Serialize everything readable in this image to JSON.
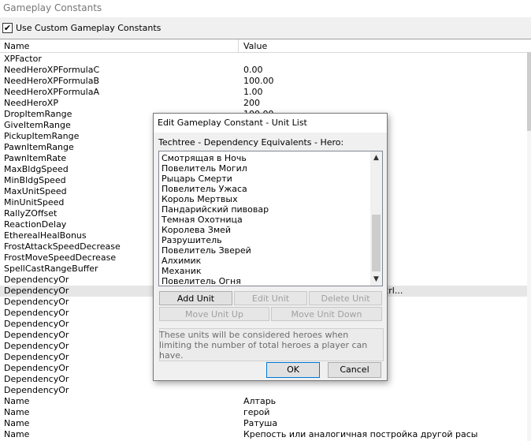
{
  "window": {
    "title": "Gameplay Constants"
  },
  "use_custom": {
    "checked_glyph": "✔",
    "label": "Use Custom Gameplay Constants"
  },
  "grid": {
    "col_name": "Name",
    "col_value": "Value",
    "rows": [
      {
        "name": "XPFactor",
        "value": ""
      },
      {
        "name": "NeedHeroXPFormulaC",
        "value": "0.00"
      },
      {
        "name": "NeedHeroXPFormulaB",
        "value": "100.00"
      },
      {
        "name": "NeedHeroXPFormulaA",
        "value": "1.00"
      },
      {
        "name": "NeedHeroXP",
        "value": "200"
      },
      {
        "name": "DropItemRange",
        "value": "100.00"
      },
      {
        "name": "GiveItemRange",
        "value": ""
      },
      {
        "name": "PickupItemRange",
        "value": ""
      },
      {
        "name": "PawnItemRange",
        "value": ""
      },
      {
        "name": "PawnItemRate",
        "value": ""
      },
      {
        "name": "MaxBldgSpeed",
        "value": ""
      },
      {
        "name": "MinBldgSpeed",
        "value": ""
      },
      {
        "name": "MaxUnitSpeed",
        "value": ""
      },
      {
        "name": "MinUnitSpeed",
        "value": ""
      },
      {
        "name": "RallyZOffset",
        "value": ""
      },
      {
        "name": "ReactionDelay",
        "value": ""
      },
      {
        "name": "EtherealHealBonus",
        "value": ""
      },
      {
        "name": "FrostAttackSpeedDecrease",
        "value": ""
      },
      {
        "name": "FrostMoveSpeedDecrease",
        "value": ""
      },
      {
        "name": "SpellCastRangeBuffer",
        "value": ""
      },
      {
        "name": "DependencyOr",
        "value": ""
      },
      {
        "name": "DependencyOr",
        "value": "d,Otch,Edem,Ekee,Emoo,Ewar,Ucrl...",
        "selected": true
      },
      {
        "name": "DependencyOr",
        "value": ""
      },
      {
        "name": "DependencyOr",
        "value": ""
      },
      {
        "name": "DependencyOr",
        "value": ""
      },
      {
        "name": "DependencyOr",
        "value": ""
      },
      {
        "name": "DependencyOr",
        "value": ""
      },
      {
        "name": "DependencyOr",
        "value": ""
      },
      {
        "name": "DependencyOr",
        "value": ""
      },
      {
        "name": "DependencyOr",
        "value": ""
      },
      {
        "name": "DependencyOr",
        "value": ""
      },
      {
        "name": "Name",
        "value": "Алтарь"
      },
      {
        "name": "Name",
        "value": "герой"
      },
      {
        "name": "Name",
        "value": "Ратуша"
      },
      {
        "name": "Name",
        "value": "Крепость или аналогичная постройка другой расы"
      }
    ]
  },
  "dialog": {
    "title": "Edit Gameplay Constant - Unit List",
    "label": "Techtree - Dependency Equivalents - Hero:",
    "items": [
      "Смотрящая в Ночь",
      "Повелитель Могил",
      "Рыцарь Смерти",
      "Повелитель Ужаса",
      "Король Мертвых",
      "Пандарийский пивовар",
      "Темная Охотница",
      "Королева Змей",
      "Разрушитель",
      "Повелитель Зверей",
      "Алхимик",
      "Механик",
      "Повелитель Огня"
    ],
    "scroll_up_glyph": "▲",
    "scroll_down_glyph": "▼",
    "buttons": {
      "add_unit": "Add Unit",
      "edit_unit": "Edit Unit",
      "delete_unit": "Delete Unit",
      "move_up": "Move Unit Up",
      "move_down": "Move Unit Down",
      "ok": "OK",
      "cancel": "Cancel"
    },
    "description": "These units will be considered heroes when limiting the number of total heroes a player can have."
  }
}
